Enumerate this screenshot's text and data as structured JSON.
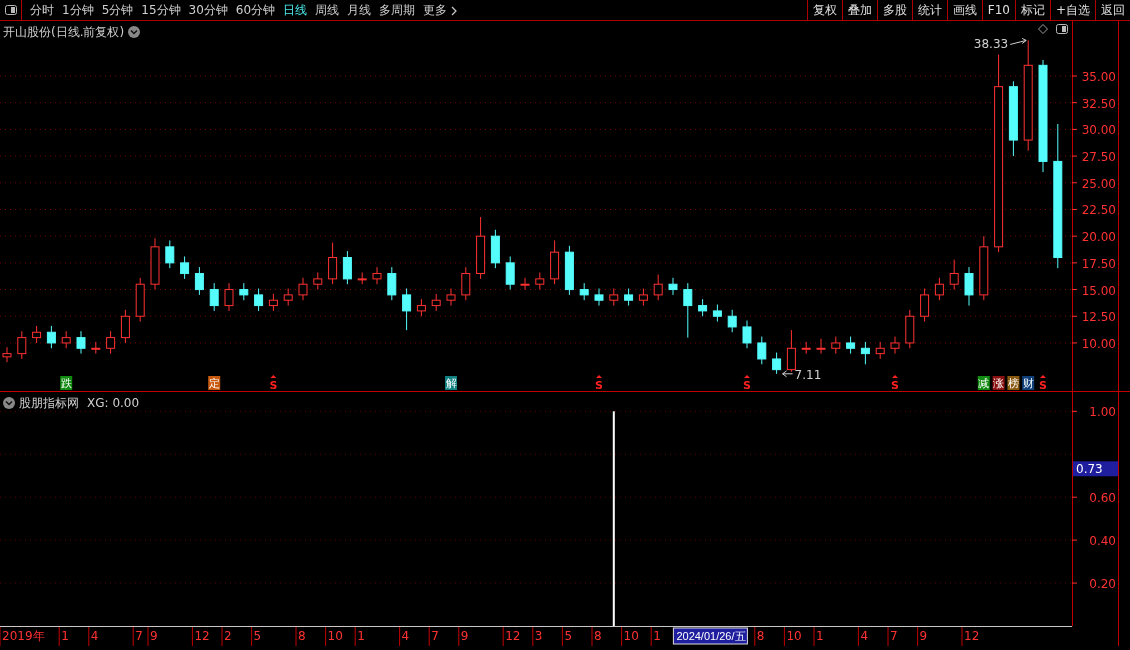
{
  "toolbar": {
    "tabs": [
      {
        "label": "分时",
        "selected": false,
        "kind": "period"
      },
      {
        "label": "1分钟",
        "selected": false,
        "kind": "period"
      },
      {
        "label": "5分钟",
        "selected": false,
        "kind": "period"
      },
      {
        "label": "15分钟",
        "selected": false,
        "kind": "period"
      },
      {
        "label": "30分钟",
        "selected": false,
        "kind": "period"
      },
      {
        "label": "60分钟",
        "selected": false,
        "kind": "period"
      },
      {
        "label": "日线",
        "selected": true,
        "kind": "period"
      },
      {
        "label": "周线",
        "selected": false,
        "kind": "period"
      },
      {
        "label": "月线",
        "selected": false,
        "kind": "period"
      },
      {
        "label": "多周期",
        "selected": false,
        "kind": "period"
      },
      {
        "label": "更多",
        "selected": false,
        "kind": "menu"
      }
    ],
    "buttons": [
      "复权",
      "叠加",
      "多股",
      "统计",
      "画线",
      "F10",
      "标记",
      "+自选",
      "返回"
    ]
  },
  "price_panel": {
    "title": "开山股份(日线.前复权)",
    "high_label": "38.33",
    "low_label": "7.11",
    "chart_data": {
      "type": "candlestick",
      "grid": true,
      "ohlc": [
        [
          8.7,
          9.6,
          8.2,
          9
        ],
        [
          9,
          11.1,
          8.5,
          10.5
        ],
        [
          10.5,
          11.6,
          10,
          11
        ],
        [
          11,
          11.6,
          9.5,
          10
        ],
        [
          10,
          11.1,
          9.5,
          10.5
        ],
        [
          10.5,
          11.1,
          9,
          9.5
        ],
        [
          9.5,
          10.1,
          9,
          9.5
        ],
        [
          9.5,
          11.1,
          9,
          10.5
        ],
        [
          10.5,
          13.1,
          10,
          12.5
        ],
        [
          12.5,
          16.1,
          12,
          15.5
        ],
        [
          15.5,
          19.8,
          15,
          19
        ],
        [
          19,
          19.6,
          17,
          17.5
        ],
        [
          17.5,
          18.1,
          16,
          16.5
        ],
        [
          16.5,
          17.1,
          14.5,
          15
        ],
        [
          15,
          15.6,
          13,
          13.5
        ],
        [
          13.5,
          15.6,
          13,
          15
        ],
        [
          15,
          15.6,
          14,
          14.5
        ],
        [
          14.5,
          15.1,
          13,
          13.5
        ],
        [
          13.5,
          14.6,
          13,
          14
        ],
        [
          14,
          15.1,
          13.5,
          14.5
        ],
        [
          14.5,
          16.1,
          14,
          15.5
        ],
        [
          15.5,
          16.6,
          15,
          16
        ],
        [
          16,
          19.4,
          15.5,
          18
        ],
        [
          18,
          18.6,
          15.5,
          16
        ],
        [
          16,
          16.6,
          15.5,
          16
        ],
        [
          16,
          17.1,
          15.5,
          16.5
        ],
        [
          16.5,
          17.1,
          14,
          14.5
        ],
        [
          14.5,
          15.1,
          11.2,
          13
        ],
        [
          13,
          14.1,
          12.5,
          13.5
        ],
        [
          13.5,
          14.6,
          13,
          14
        ],
        [
          14,
          15.1,
          13.5,
          14.5
        ],
        [
          14.5,
          17.1,
          14,
          16.5
        ],
        [
          16.5,
          21.8,
          16,
          20
        ],
        [
          20,
          20.6,
          17,
          17.5
        ],
        [
          17.5,
          18.1,
          15,
          15.5
        ],
        [
          15.5,
          16.1,
          15,
          15.5
        ],
        [
          15.5,
          16.6,
          15,
          16
        ],
        [
          16,
          19.6,
          15.5,
          18.5
        ],
        [
          18.5,
          19.1,
          14.5,
          15
        ],
        [
          15,
          15.6,
          14,
          14.5
        ],
        [
          14.5,
          15.1,
          13.5,
          14
        ],
        [
          14,
          15.1,
          13.5,
          14.5
        ],
        [
          14.5,
          15.1,
          13.5,
          14
        ],
        [
          14,
          15.1,
          13.5,
          14.5
        ],
        [
          14.5,
          16.4,
          14,
          15.5
        ],
        [
          15.5,
          16.1,
          14.5,
          15
        ],
        [
          15,
          15.6,
          10.5,
          13.5
        ],
        [
          13.5,
          14.1,
          12.5,
          13
        ],
        [
          13,
          13.6,
          12,
          12.5
        ],
        [
          12.5,
          13.1,
          11,
          11.5
        ],
        [
          11.5,
          12.1,
          9.5,
          10
        ],
        [
          10,
          10.6,
          8,
          8.5
        ],
        [
          8.5,
          9.1,
          7.11,
          7.5
        ],
        [
          7.5,
          11.2,
          7.3,
          9.5
        ],
        [
          9.5,
          10.1,
          9,
          9.5
        ],
        [
          9.5,
          10.4,
          9,
          9.5
        ],
        [
          9.5,
          10.6,
          9,
          10
        ],
        [
          10,
          10.6,
          9,
          9.5
        ],
        [
          9.5,
          10.1,
          8,
          9
        ],
        [
          9,
          10.1,
          8.5,
          9.5
        ],
        [
          9.5,
          10.6,
          9,
          10
        ],
        [
          10,
          13.1,
          9.5,
          12.5
        ],
        [
          12.5,
          15.1,
          12,
          14.5
        ],
        [
          14.5,
          16.1,
          14,
          15.5
        ],
        [
          15.5,
          17.8,
          15,
          16.5
        ],
        [
          16.5,
          17.1,
          13.5,
          14.5
        ],
        [
          14.5,
          20,
          14,
          19
        ],
        [
          19,
          37,
          18.5,
          34
        ],
        [
          34,
          34.5,
          27.5,
          29
        ],
        [
          29,
          38.33,
          28,
          36
        ],
        [
          36,
          36.5,
          26,
          27
        ],
        [
          27,
          30.5,
          17,
          18
        ]
      ],
      "ylim": [
        5.5,
        40.15
      ],
      "yticks": [
        {
          "value": 10,
          "label": "10.00"
        },
        {
          "value": 12.5,
          "label": "12.50"
        },
        {
          "value": 15,
          "label": "15.00"
        },
        {
          "value": 17.5,
          "label": "17.50"
        },
        {
          "value": 20,
          "label": "20.00"
        },
        {
          "value": 22.5,
          "label": "22.50"
        },
        {
          "value": 25,
          "label": "25.00"
        },
        {
          "value": 27.5,
          "label": "27.50"
        },
        {
          "value": 30,
          "label": "30.00"
        },
        {
          "value": 32.5,
          "label": "32.50"
        },
        {
          "value": 35,
          "label": "35.00"
        }
      ]
    },
    "signals": [
      {
        "kind": "tag",
        "text": "跌",
        "color": "#108a10"
      },
      {
        "kind": "tag",
        "text": "定",
        "color": "#c85a10"
      },
      {
        "kind": "signal",
        "text": "S",
        "color": "#ff2020"
      },
      {
        "kind": "tag",
        "text": "解",
        "color": "#108080"
      },
      {
        "kind": "signal",
        "text": "S",
        "color": "#ff2020"
      },
      {
        "kind": "signal",
        "text": "S",
        "color": "#ff2020"
      },
      {
        "kind": "signal",
        "text": "S",
        "color": "#ff2020"
      },
      {
        "kind": "tag",
        "text": "减",
        "color": "#108a10"
      },
      {
        "kind": "tag",
        "text": "涨",
        "color": "#8a1010"
      },
      {
        "kind": "tag",
        "text": "榜",
        "color": "#8a5a10"
      },
      {
        "kind": "tag",
        "text": "财",
        "color": "#10407a"
      },
      {
        "kind": "signal",
        "text": "S",
        "color": "#ff2020"
      }
    ]
  },
  "indicator_panel": {
    "title": "股朋指标网",
    "reading": "XG: 0.00",
    "cursor_value": "0.73",
    "chart_data": {
      "type": "bar",
      "grid": true,
      "ylim": [
        0,
        1.09
      ],
      "categories": [
        "2019年",
        null,
        null,
        null,
        "1",
        null,
        "4",
        null,
        null,
        "7",
        "9",
        null,
        null,
        "12",
        null,
        "2",
        null,
        "5",
        null,
        null,
        "8",
        null,
        "10",
        null,
        "1",
        null,
        null,
        "4",
        null,
        "7",
        null,
        "9",
        null,
        null,
        "12",
        null,
        "3",
        null,
        "5",
        null,
        "8",
        null,
        "10",
        null,
        "1",
        null,
        null,
        null,
        null,
        null,
        null,
        "8",
        null,
        "10",
        null,
        "1",
        null,
        null,
        "4",
        null,
        "7",
        null,
        "9",
        null,
        null,
        "12",
        null,
        null,
        null,
        null,
        null,
        null
      ],
      "yticks": [
        {
          "value": 0.2,
          "label": "0.20"
        },
        {
          "value": 0.4,
          "label": "0.40"
        },
        {
          "value": 0.6,
          "label": "0.60"
        },
        {
          "value": 1,
          "label": "1.00"
        }
      ],
      "values": [
        0,
        0,
        0,
        0,
        0,
        0,
        0,
        0,
        0,
        0,
        0,
        0,
        0,
        0,
        0,
        0,
        0,
        0,
        0,
        0,
        0,
        0,
        0,
        0,
        0,
        0,
        0,
        0,
        0,
        0,
        0,
        0,
        0,
        0,
        0,
        0,
        0,
        0,
        0,
        0,
        0,
        1,
        0,
        0,
        0,
        0,
        0,
        0,
        0,
        0,
        0,
        0,
        0,
        0,
        0,
        0,
        0,
        0,
        0,
        0,
        0,
        0,
        0,
        0,
        0,
        0,
        0,
        0,
        0,
        0,
        0,
        0
      ]
    }
  },
  "time_axis": {
    "cursor_label": "2024/01/26/五"
  }
}
